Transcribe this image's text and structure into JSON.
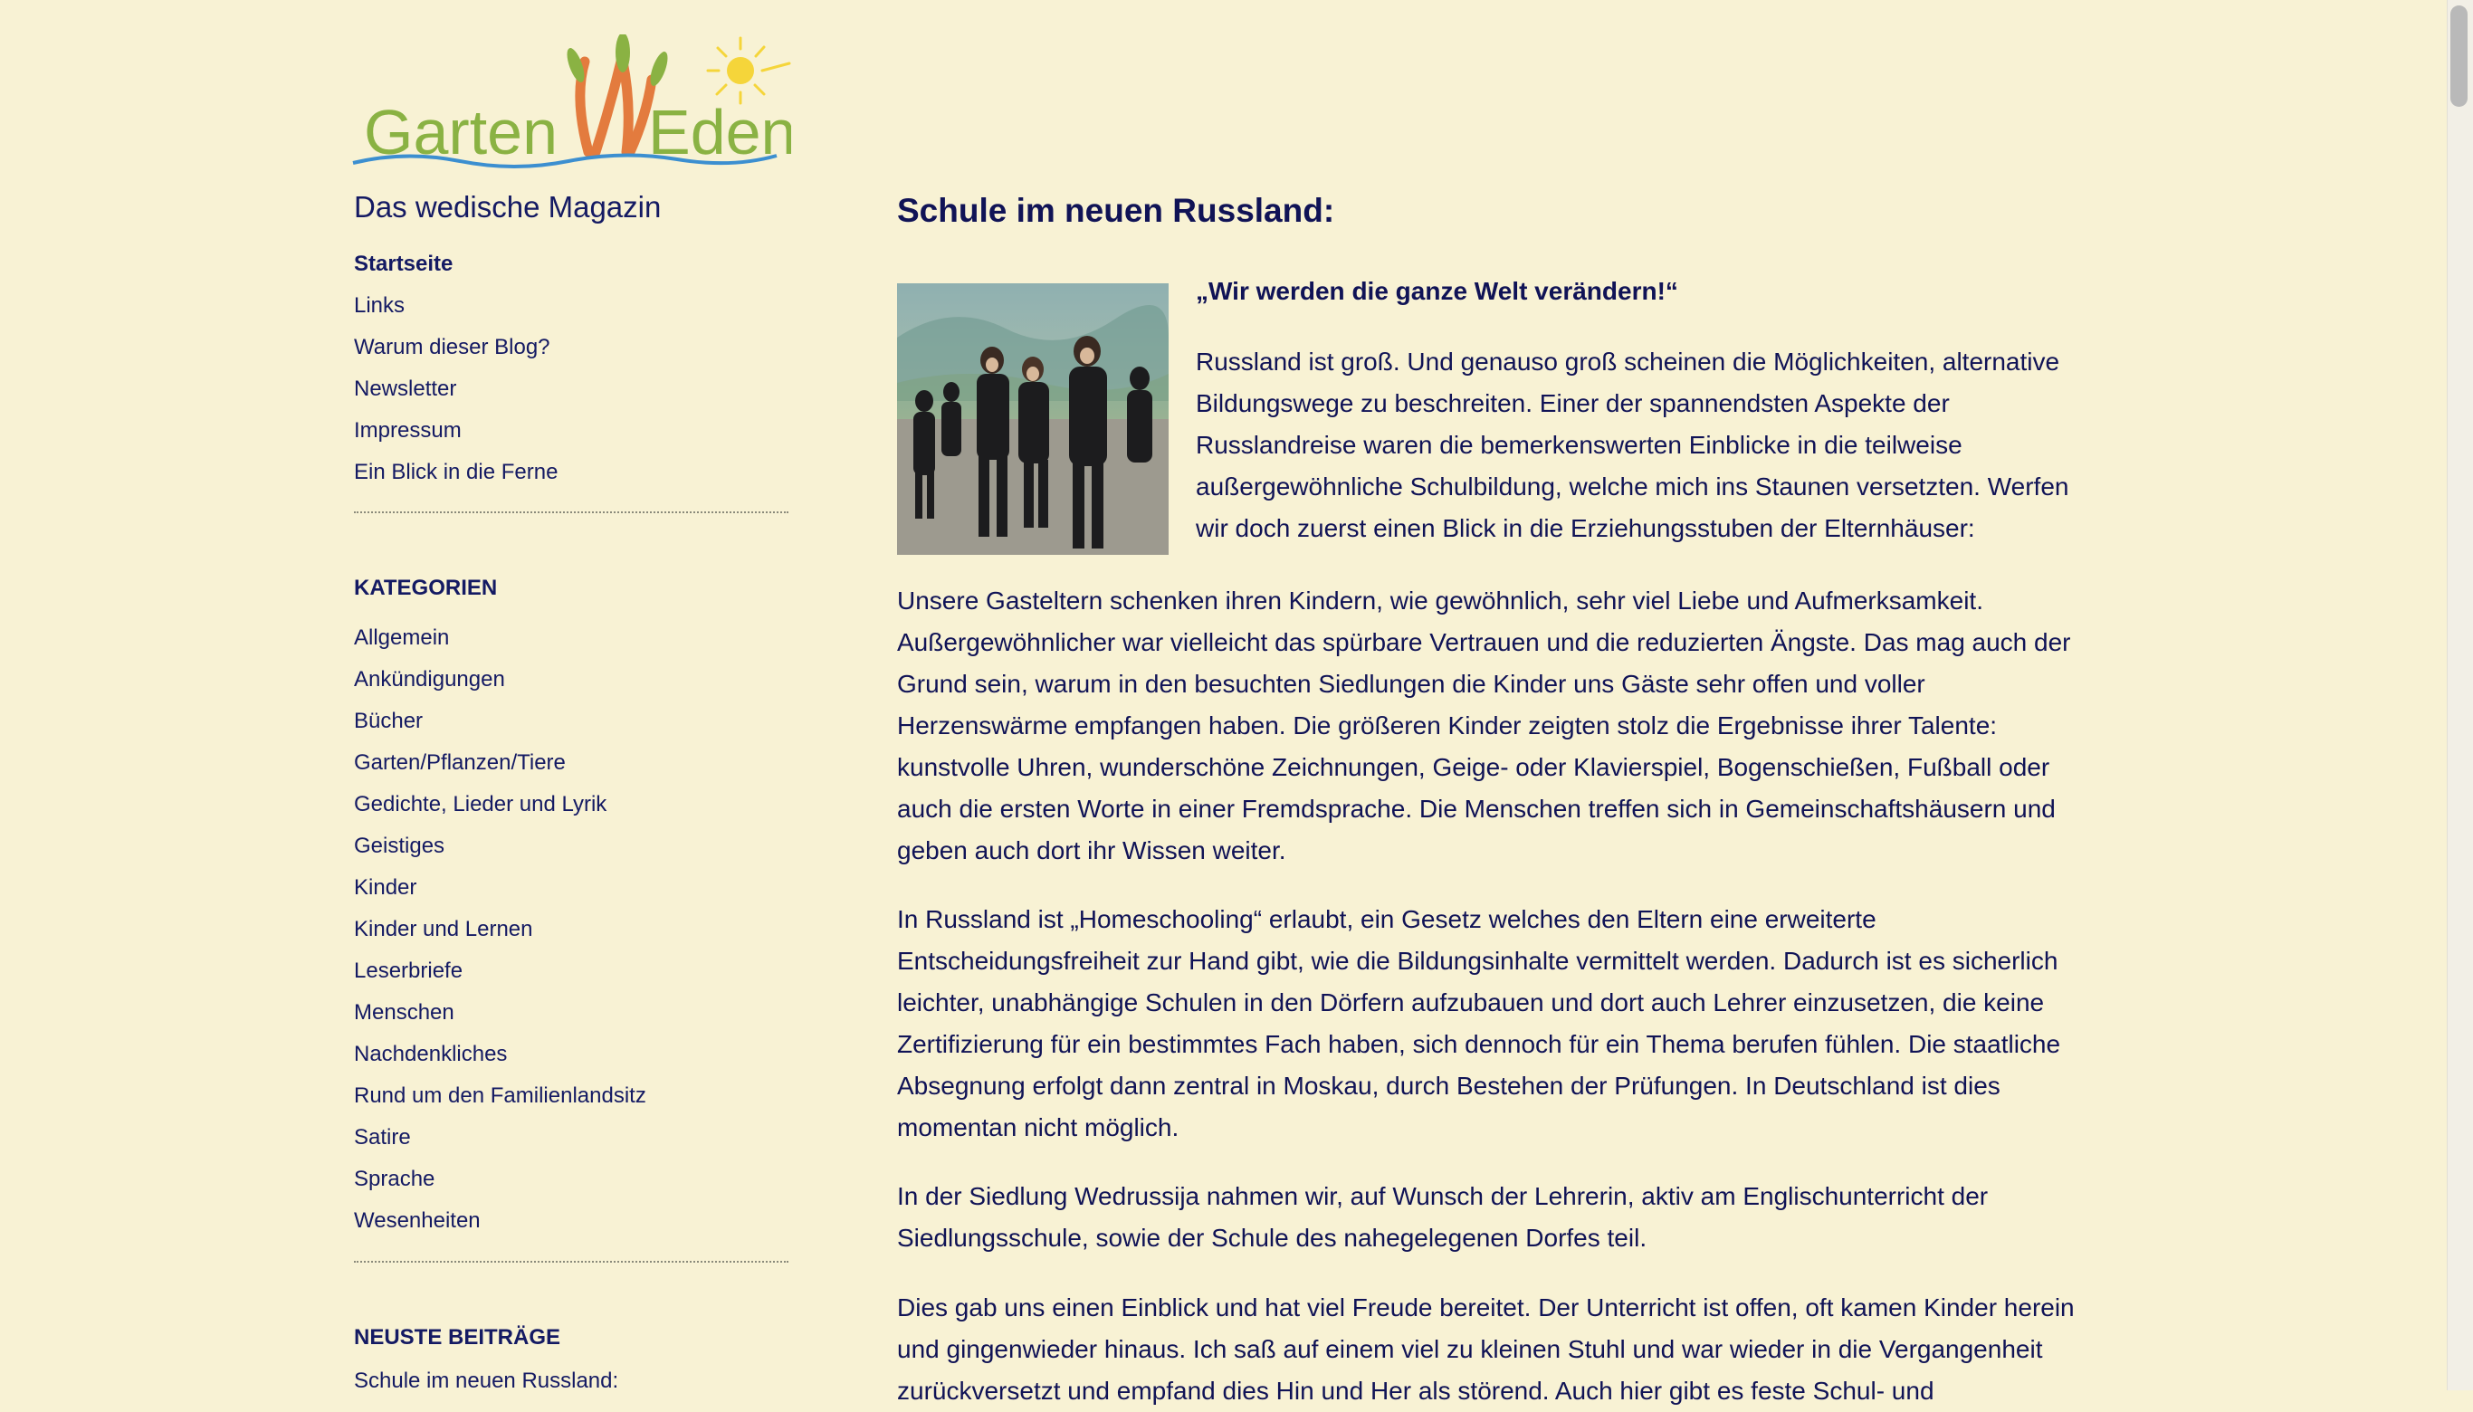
{
  "site": {
    "logo_text": "GartenWEden",
    "tagline": "Das wedische Magazin"
  },
  "nav": [
    {
      "label": "Startseite"
    },
    {
      "label": "Links"
    },
    {
      "label": "Warum dieser Blog?"
    },
    {
      "label": "Newsletter"
    },
    {
      "label": "Impressum"
    },
    {
      "label": "Ein Blick in die Ferne"
    }
  ],
  "categories": {
    "heading": "KATEGORIEN",
    "items": [
      {
        "label": "Allgemein"
      },
      {
        "label": "Ankündigungen"
      },
      {
        "label": "Bücher"
      },
      {
        "label": "Garten/Pflanzen/Tiere"
      },
      {
        "label": "Gedichte, Lieder und Lyrik"
      },
      {
        "label": "Geistiges"
      },
      {
        "label": "Kinder"
      },
      {
        "label": "Kinder und Lernen"
      },
      {
        "label": "Leserbriefe"
      },
      {
        "label": "Menschen"
      },
      {
        "label": "Nachdenkliches"
      },
      {
        "label": "Rund um den Familienlandsitz"
      },
      {
        "label": "Satire"
      },
      {
        "label": "Sprache"
      },
      {
        "label": "Wesenheiten"
      }
    ]
  },
  "recent": {
    "heading": "NEUSTE BEITRÄGE",
    "items": [
      {
        "label": "Schule im neuen Russland:"
      }
    ]
  },
  "article": {
    "title": "Schule im neuen Russland:",
    "subheading": "„Wir werden die ganze Welt verändern!“",
    "paragraphs": [
      "Russland ist groß. Und genauso groß scheinen die Möglichkeiten, alternative Bildungswege zu beschreiten. Einer der spannendsten Aspekte der Russlandreise waren die bemerkenswerten Einblicke in die teilweise außergewöhnliche Schulbildung, welche mich ins Staunen versetzten. Werfen wir doch zuerst einen Blick in die Erziehungsstuben der Elternhäuser:",
      "Unsere Gasteltern schenken ihren Kindern, wie gewöhnlich, sehr viel Liebe und Aufmerksamkeit. Außergewöhnlicher war vielleicht das spürbare Vertrauen und die reduzierten Ängste. Das mag auch der Grund sein, warum in den besuchten Siedlungen die Kinder uns Gäste sehr offen und voller Herzenswärme empfangen haben. Die größeren Kinder zeigten stolz die Ergebnisse ihrer Talente: kunstvolle Uhren, wunderschöne Zeichnungen, Geige- oder Klavierspiel, Bogenschießen, Fußball oder auch die ersten Worte in einer Fremdsprache. Die Menschen treffen sich in Gemeinschaftshäusern und geben auch dort ihr Wissen weiter.",
      "In Russland ist „Homeschooling“ erlaubt, ein Gesetz welches den Eltern eine erweiterte Entscheidungsfreiheit zur Hand gibt, wie die Bildungsinhalte vermittelt werden. Dadurch ist es sicherlich leichter, unabhängige Schulen in den Dörfern aufzubauen und dort auch Lehrer einzusetzen, die keine Zertifizierung für ein bestimmtes Fach haben, sich dennoch für ein Thema berufen fühlen. Die staatliche Absegnung erfolgt dann zentral in Moskau, durch Bestehen der Prüfungen. In Deutschland ist dies momentan nicht möglich.",
      "In der Siedlung Wedrussija nahmen wir, auf Wunsch der Lehrerin, aktiv am Englischunterricht der Siedlungsschule, sowie der Schule des nahegelegenen Dorfes teil.",
      "Dies gab uns einen Einblick und hat viel Freude bereitet. Der Unterricht ist offen, oft kamen Kinder herein und gingenwieder hinaus. Ich saß auf einem viel zu kleinen Stuhl und war wieder in die Vergangenheit zurückversetzt und empfand dies Hin und Her als störend. Auch hier gibt es feste Schul- und"
    ]
  },
  "colors": {
    "background": "#f8f2d4",
    "text": "#101356",
    "logo_green": "#8ab243",
    "logo_orange": "#e37b3e",
    "logo_sun": "#f5d53a",
    "logo_wave": "#3c8fd0"
  }
}
